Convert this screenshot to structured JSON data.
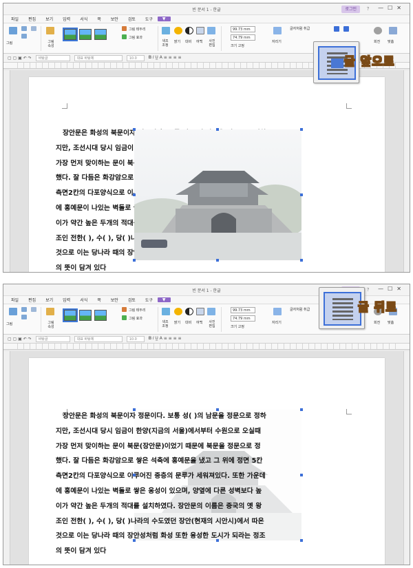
{
  "window": {
    "title": "빈 문서 1 - 한글",
    "login": "로그인",
    "extra_controls": "⇄ ✥ ？"
  },
  "menu": [
    "파일",
    "편집",
    "보기",
    "입력",
    "서식",
    "쪽",
    "보안",
    "검토",
    "도구"
  ],
  "ribbon": {
    "picture": "그림",
    "picture_props": "그림\n속성",
    "picture_border": "그림 테두리",
    "picture_effect": "그림 효과",
    "color_adjust": "색조\n조정",
    "brightness": "밝기",
    "contrast": "대비",
    "margins": "여백",
    "photo_edit": "사진\n편집",
    "width_value": "99.73",
    "height_value": "74.79",
    "unit": "mm",
    "lock_ratio": "크기 고정",
    "arrange": "자리기",
    "treat_as_char": "글자처럼 취급",
    "rotate": "회전",
    "group": "묶기",
    "arrange_label": "맞춤"
  },
  "toolbar": {
    "style_box": "바탕글",
    "font_box": "대표 바탕체",
    "size_box": "10.0"
  },
  "document": {
    "lines": [
      "장안문은 화성의 북문이자 정문이다. 보통 성(  )의 남문을 정문으로 정하",
      "지만, 조선시대 당시 임금이 한양(지금의 서울)에서부터 수원으로 오실때",
      "가장 먼저 맞이하는 문이 북문(장안문)이었기 때문에 북문을 정문으로 정",
      "했다. 잘 다듬은 화강암으로 쌓은 석축에 홍예문을 냈고 그 위에 정면 5칸",
      "측면2칸의 다포양식으로 이루어진 중층의 문루가 세워져있다. 또한 가운데",
      "에 홍예문이 나있는 벽돌로 쌓은 옹성이 있으며, 양옆에 다른 성벽보다 높",
      "이가 약간 높은 두개의 적대를 설치하였다. 장안문의 이름은 중국의 옛 왕",
      "조인 전한(   ), 수(  ), 당(  )나라의 수도였던 장안(현재의 시안시)에서 따온",
      "것으로 이는 당나라 때의 장안성처럼 화성 또한 융성한 도시가 되라는 정조",
      "의 뜻이 담겨 있다"
    ]
  },
  "callouts": {
    "front": "글 앞으로",
    "behind": "글 뒤로"
  },
  "colors": {
    "accent": "#8e68c8",
    "selection": "#3c6fd8"
  }
}
